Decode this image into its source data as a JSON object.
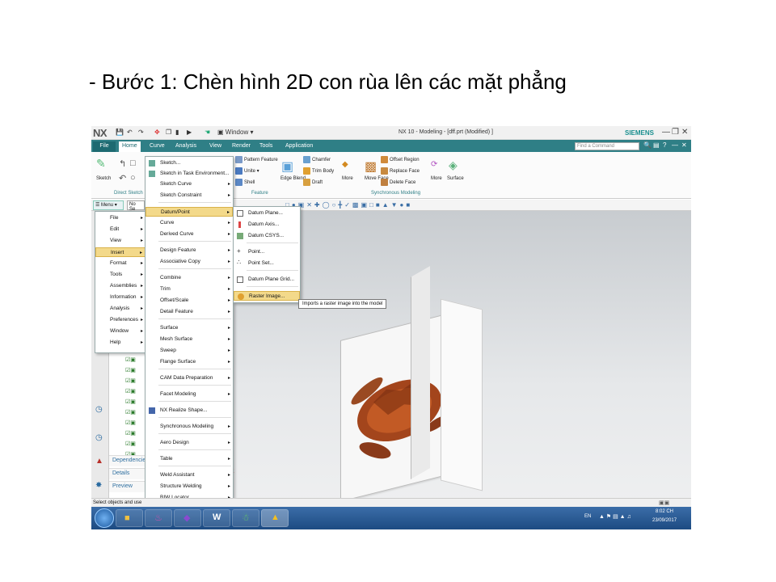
{
  "slide": {
    "title": "- Bước 1: Chèn hình 2D con rùa lên các mặt phẳng"
  },
  "titlebar": {
    "logo": "NX",
    "window_menu": "Window",
    "title": "NX 10 - Modeling - [dff.prt (Modified) ]",
    "brand": "SIEMENS"
  },
  "tabs": [
    "File",
    "Home",
    "Curve",
    "Analysis",
    "View",
    "Render",
    "Tools",
    "Application"
  ],
  "find_command_placeholder": "Find a Command",
  "ribbon": {
    "sketch": "Sketch",
    "direct_sketch": "Direct Sketch",
    "feature_items": [
      "Pattern Feature",
      "Unite",
      "Shell",
      "Chamfer",
      "Trim Body",
      "Draft",
      "Edge Blend",
      "More"
    ],
    "feature_label": "Feature",
    "sync_items": [
      "Move Face",
      "Offset Region",
      "Replace Face",
      "Delete Face",
      "More",
      "Surface"
    ],
    "sync_label": "Synchronous Modeling"
  },
  "toolbar": {
    "menu": "Menu",
    "selection": "No Se"
  },
  "main_menu": [
    "File",
    "Edit",
    "View",
    "Insert",
    "Format",
    "Tools",
    "Assemblies",
    "Information",
    "Analysis",
    "Preferences",
    "Window",
    "Help"
  ],
  "insert_menu": [
    "Sketch...",
    "Sketch in Task Environment...",
    "Sketch Curve",
    "Sketch Constraint",
    "Datum/Point",
    "Curve",
    "Derived Curve",
    "Design Feature",
    "Associative Copy",
    "Combine",
    "Trim",
    "Offset/Scale",
    "Detail Feature",
    "Surface",
    "Mesh Surface",
    "Sweep",
    "Flange Surface",
    "CAM Data Preparation",
    "Facet Modeling",
    "NX Realize Shape...",
    "Synchronous Modeling",
    "Aero Design",
    "Table",
    "Weld Assistant",
    "Structure Welding",
    "BIW Locator"
  ],
  "datum_menu": [
    "Datum Plane...",
    "Datum Axis...",
    "Datum CSYS...",
    "Point...",
    "Point Set...",
    "Datum Plane Grid...",
    "Raster Image..."
  ],
  "tooltip": "Imports a raster image into the model",
  "navigator_tabs": [
    "Dependencies",
    "Details",
    "Preview"
  ],
  "status": "Select objects and use",
  "axis_label": "X",
  "tray": {
    "lang": "EN",
    "time": "8:02 CH",
    "date": "23/09/2017"
  }
}
